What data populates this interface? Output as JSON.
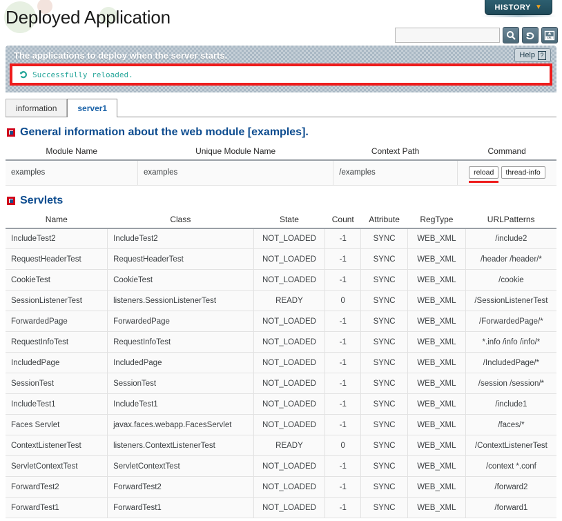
{
  "header": {
    "title": "Deployed Application",
    "history_label": "HISTORY",
    "history_chevron": "chevron-down-icon",
    "search_value": "",
    "search_placeholder": "",
    "tools": [
      {
        "name": "search-icon",
        "title": "Search"
      },
      {
        "name": "reload-icon",
        "title": "Reload"
      },
      {
        "name": "xml-export-icon",
        "title": "XML"
      }
    ]
  },
  "description_bar": {
    "text": "The applications to deploy when the server starts.",
    "help_label": "Help",
    "help_icon": "question-mark-icon",
    "message": {
      "icon": "refresh-circle-icon",
      "text": "Successfully reloaded.",
      "color": "#26a69a",
      "highlight_color": "#ee1c1c"
    }
  },
  "tabs": [
    {
      "label": "information",
      "active": false
    },
    {
      "label": "server1",
      "active": true
    }
  ],
  "general_section": {
    "title": "General information about the web module [examples].",
    "columns": [
      "Module Name",
      "Unique Module Name",
      "Context Path",
      "Command"
    ],
    "row": {
      "module_name": "examples",
      "unique_module_name": "examples",
      "context_path": "/examples",
      "commands": [
        {
          "label": "reload",
          "highlighted": true
        },
        {
          "label": "thread-info",
          "highlighted": false
        }
      ]
    }
  },
  "servlets_section": {
    "title": "Servlets",
    "columns": [
      "Name",
      "Class",
      "State",
      "Count",
      "Attribute",
      "RegType",
      "URLPatterns"
    ],
    "rows": [
      [
        "IncludeTest2",
        "IncludeTest2",
        "NOT_LOADED",
        "-1",
        "SYNC",
        "WEB_XML",
        "/include2"
      ],
      [
        "RequestHeaderTest",
        "RequestHeaderTest",
        "NOT_LOADED",
        "-1",
        "SYNC",
        "WEB_XML",
        "/header /header/*"
      ],
      [
        "CookieTest",
        "CookieTest",
        "NOT_LOADED",
        "-1",
        "SYNC",
        "WEB_XML",
        "/cookie"
      ],
      [
        "SessionListenerTest",
        "listeners.SessionListenerTest",
        "READY",
        "0",
        "SYNC",
        "WEB_XML",
        "/SessionListenerTest"
      ],
      [
        "ForwardedPage",
        "ForwardedPage",
        "NOT_LOADED",
        "-1",
        "SYNC",
        "WEB_XML",
        "/ForwardedPage/*"
      ],
      [
        "RequestInfoTest",
        "RequestInfoTest",
        "NOT_LOADED",
        "-1",
        "SYNC",
        "WEB_XML",
        "*.info /info /info/*"
      ],
      [
        "IncludedPage",
        "IncludedPage",
        "NOT_LOADED",
        "-1",
        "SYNC",
        "WEB_XML",
        "/IncludedPage/*"
      ],
      [
        "SessionTest",
        "SessionTest",
        "NOT_LOADED",
        "-1",
        "SYNC",
        "WEB_XML",
        "/session /session/*"
      ],
      [
        "IncludeTest1",
        "IncludeTest1",
        "NOT_LOADED",
        "-1",
        "SYNC",
        "WEB_XML",
        "/include1"
      ],
      [
        "Faces Servlet",
        "javax.faces.webapp.FacesServlet",
        "NOT_LOADED",
        "-1",
        "SYNC",
        "WEB_XML",
        "/faces/*"
      ],
      [
        "ContextListenerTest",
        "listeners.ContextListenerTest",
        "READY",
        "0",
        "SYNC",
        "WEB_XML",
        "/ContextListenerTest"
      ],
      [
        "ServletContextTest",
        "ServletContextTest",
        "NOT_LOADED",
        "-1",
        "SYNC",
        "WEB_XML",
        "/context *.conf"
      ],
      [
        "ForwardTest2",
        "ForwardTest2",
        "NOT_LOADED",
        "-1",
        "SYNC",
        "WEB_XML",
        "/forward2"
      ],
      [
        "ForwardTest1",
        "ForwardTest1",
        "NOT_LOADED",
        "-1",
        "SYNC",
        "WEB_XML",
        "/forward1"
      ]
    ]
  }
}
